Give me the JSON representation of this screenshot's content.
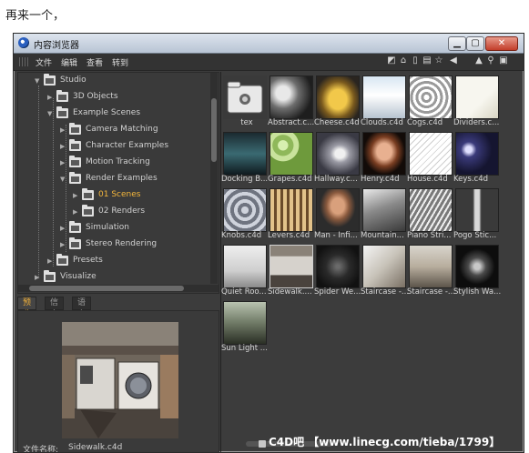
{
  "caption": "再来一个，",
  "window": {
    "title": "内容浏览器"
  },
  "menu": [
    "文件",
    "编辑",
    "查看",
    "转到"
  ],
  "toolbar_icons": [
    "rename-icon",
    "home-icon",
    "trash-icon",
    "book-icon",
    "star-icon",
    "back-icon",
    "up-icon",
    "search-icon",
    "panel-icon"
  ],
  "tree": [
    {
      "label": "Studio",
      "depth": 0
    },
    {
      "label": "3D Objects",
      "depth": 1
    },
    {
      "label": "Example Scenes",
      "depth": 1
    },
    {
      "label": "Camera Matching",
      "depth": 2
    },
    {
      "label": "Character Examples",
      "depth": 2
    },
    {
      "label": "Motion Tracking",
      "depth": 2
    },
    {
      "label": "Render Examples",
      "depth": 2
    },
    {
      "label": "01 Scenes",
      "depth": 3
    },
    {
      "label": "02 Renders",
      "depth": 3
    },
    {
      "label": "Simulation",
      "depth": 2
    },
    {
      "label": "Stereo Rendering",
      "depth": 2
    },
    {
      "label": "Presets",
      "depth": 1
    },
    {
      "label": "Visualize",
      "depth": 0
    }
  ],
  "tabs": [
    "预览",
    "信息",
    "语言"
  ],
  "preview": {
    "label": "文件名称:",
    "value": "Sidewalk.c4d"
  },
  "files": [
    "tex",
    "Abstract.c...",
    "Cheese.c4d",
    "Clouds.c4d",
    "Cogs.c4d",
    "Dividers.c...",
    "Docking B...",
    "Grapes.c4d",
    "Hallway.c...",
    "Henry.c4d",
    "House.c4d",
    "Keys.c4d",
    "Knobs.c4d",
    "Levers.c4d",
    "Man - Infi...",
    "Mountain...",
    "Piano Stri...",
    "Pogo Stic...",
    "Quiet Roo...",
    "Sidewalk....",
    "Spider We...",
    "Staircase -...",
    "Staircase -...",
    "Stylish Wa...",
    "Sun Light ..."
  ],
  "watermark": "C4D吧 【www.linecg.com/tieba/1799】",
  "colors": {
    "window_bg": "#3c3c3c",
    "selected_text": "#f5b73c",
    "tab_active": "#f2b13a"
  }
}
